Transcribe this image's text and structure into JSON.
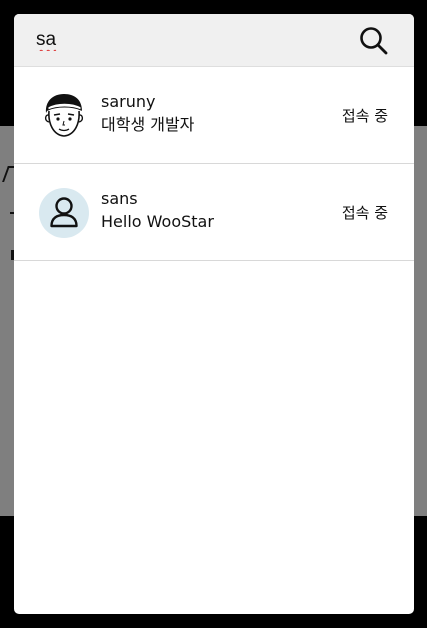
{
  "search": {
    "value": "sa",
    "button_icon": "search-icon"
  },
  "results": [
    {
      "name": "saruny",
      "status_message": "대학생 개발자",
      "online": "접속 중",
      "avatar": "cartoon-face-avatar"
    },
    {
      "name": "sans",
      "status_message": "Hello WooStar",
      "online": "접속 중",
      "avatar": "default-user-avatar"
    }
  ],
  "colors": {
    "overlay_top": "#000000",
    "backdrop": "#7f7f7f",
    "panel": "#ffffff",
    "search_bar": "#f0f0f0",
    "default_avatar_bg": "#d9e9f0"
  }
}
